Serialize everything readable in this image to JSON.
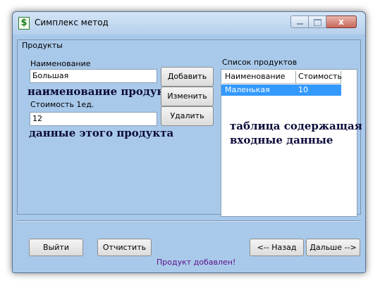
{
  "window": {
    "title": "Симплекс метод",
    "icon": "dollar-icon",
    "close_symbol": "x"
  },
  "group": {
    "label": "Продукты"
  },
  "form": {
    "name_label": "Наименование",
    "name_value": "Большая",
    "cost_label": "Стоимость 1ед.",
    "cost_value": "12"
  },
  "buttons": {
    "add": "Добавить",
    "edit": "Изменить",
    "delete": "Удалить",
    "exit": "Выйти",
    "clear": "Отчистить",
    "back": "<-- Назад",
    "next": "Дальше -->"
  },
  "product_list": {
    "label": "Список продуктов",
    "columns": [
      "Наименование",
      "Стоимость"
    ],
    "rows": [
      [
        "Маленькая",
        "10"
      ]
    ]
  },
  "annotations": {
    "name_note": "наименование продукта",
    "data_note": "данные этого продукта",
    "table_note_line1": "таблица содержащая",
    "table_note_line2": "входные данные"
  },
  "status": "Продукт добавлен!",
  "colors": {
    "window_bg": "#a9c9ea",
    "selection": "#3399ff",
    "status_text": "#5b0f8a"
  }
}
